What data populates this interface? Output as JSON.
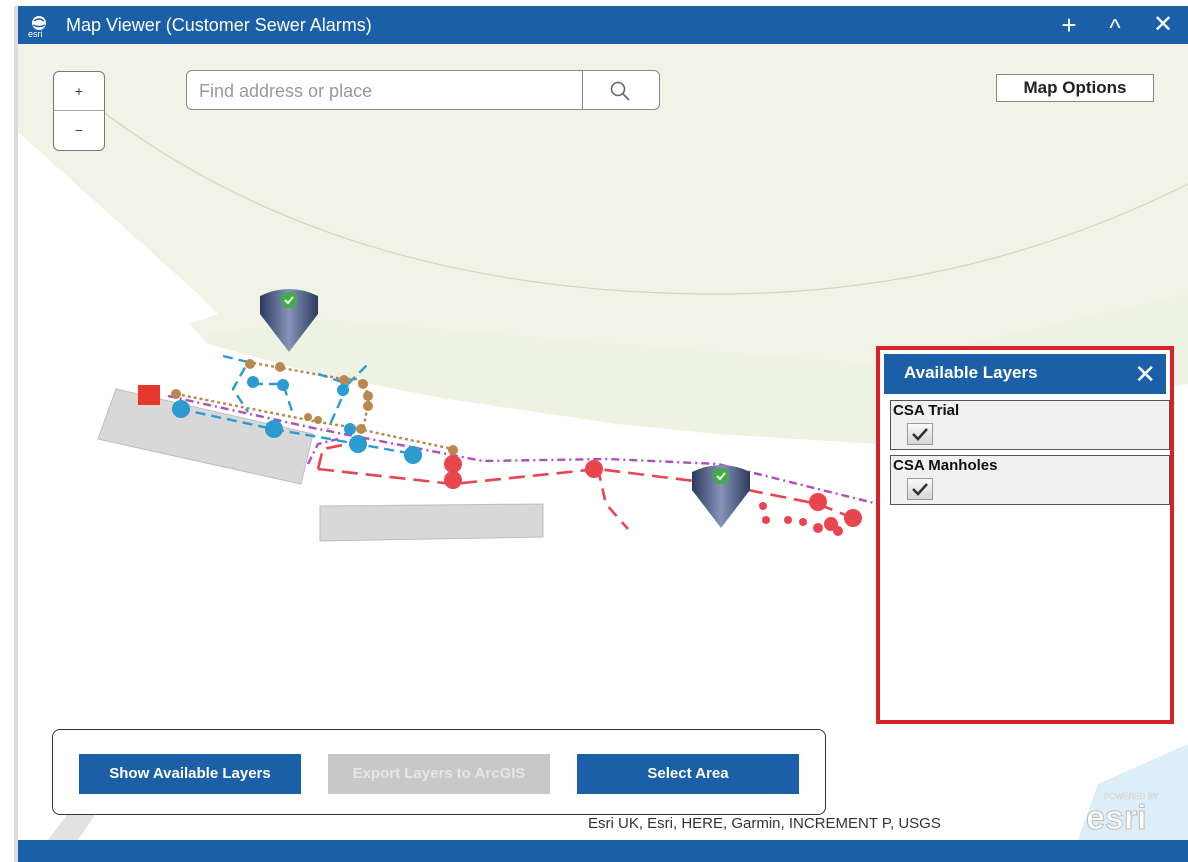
{
  "window": {
    "title": "Map Viewer (Customer Sewer Alarms)",
    "logo_icon": "esri-globe-icon",
    "controls": [
      {
        "icon": "plus-icon",
        "glyph": "+"
      },
      {
        "icon": "chevron-up-icon",
        "glyph": "^"
      },
      {
        "icon": "close-icon",
        "glyph": "✕"
      }
    ]
  },
  "map": {
    "zoom": {
      "in_label": "+",
      "out_label": "−"
    },
    "search": {
      "placeholder": "Find address or place",
      "value": "",
      "icon": "search-icon"
    },
    "map_options_label": "Map Options",
    "markers": [
      {
        "icon": "map-pin-check-icon"
      },
      {
        "icon": "map-pin-check-icon"
      }
    ],
    "attribution": "Esri UK, Esri, HERE, Garmin, INCREMENT P, USGS",
    "powered_by": "POWERED BY",
    "brand": "esri"
  },
  "layers_panel": {
    "title": "Available Layers",
    "close_icon": "close-icon",
    "layers": [
      {
        "name": "CSA Trial",
        "checked": true
      },
      {
        "name": "CSA Manholes",
        "checked": true
      }
    ]
  },
  "toolbar": {
    "show_layers_label": "Show Available Layers",
    "export_label": "Export Layers to ArcGIS",
    "export_enabled": false,
    "select_area_label": "Select Area"
  },
  "colors": {
    "header_blue": "#1a5fa8",
    "highlight_red": "#d8222a",
    "sewer_red": "#e8454f",
    "water_blue": "#2b9bd1",
    "brown": "#b9874f",
    "purple": "#b04cbf"
  }
}
